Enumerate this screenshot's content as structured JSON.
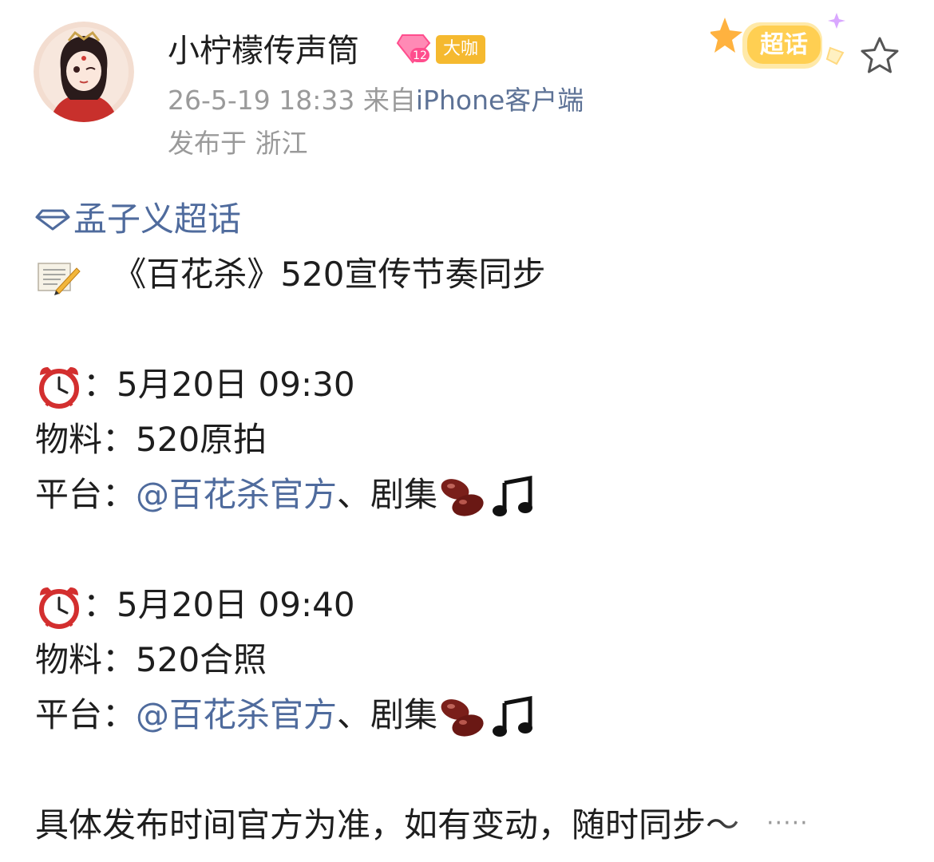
{
  "header": {
    "username": "小柠檬传声筒",
    "level": "12",
    "vip_label": "大咖",
    "datetime": "26-5-19 18:33",
    "source_prefix": "来自",
    "source_client": "iPhone客户端",
    "location": "发布于 浙江",
    "chaohua_sticker": "超话"
  },
  "post": {
    "topic": "孟子义超话",
    "headline": "《百花杀》520宣传节奏同步",
    "items": [
      {
        "time": "：5月20日 09:30",
        "material_label": "物料：",
        "material": "520原拍",
        "platform_label": "平台：",
        "platform_link": "@百花杀官方",
        "platform_rest": "、剧集"
      },
      {
        "time": "：5月20日 09:40",
        "material_label": "物料：",
        "material": "520合照",
        "platform_label": "平台：",
        "platform_link": "@百花杀官方",
        "platform_rest": "、剧集"
      }
    ],
    "footer": "具体发布时间官方为准，如有变动，随时同步～"
  },
  "icons": {
    "topic": "diamond-icon",
    "memo": "memo-icon",
    "alarm": "alarm-clock-icon",
    "beans": "beans-icon",
    "music": "music-notes-icon",
    "star": "star-outline-icon"
  },
  "colors": {
    "link": "#4f6b9d",
    "meta": "#9a9a9a",
    "vip": "#f5b92f",
    "level": "#ff4d8d"
  }
}
